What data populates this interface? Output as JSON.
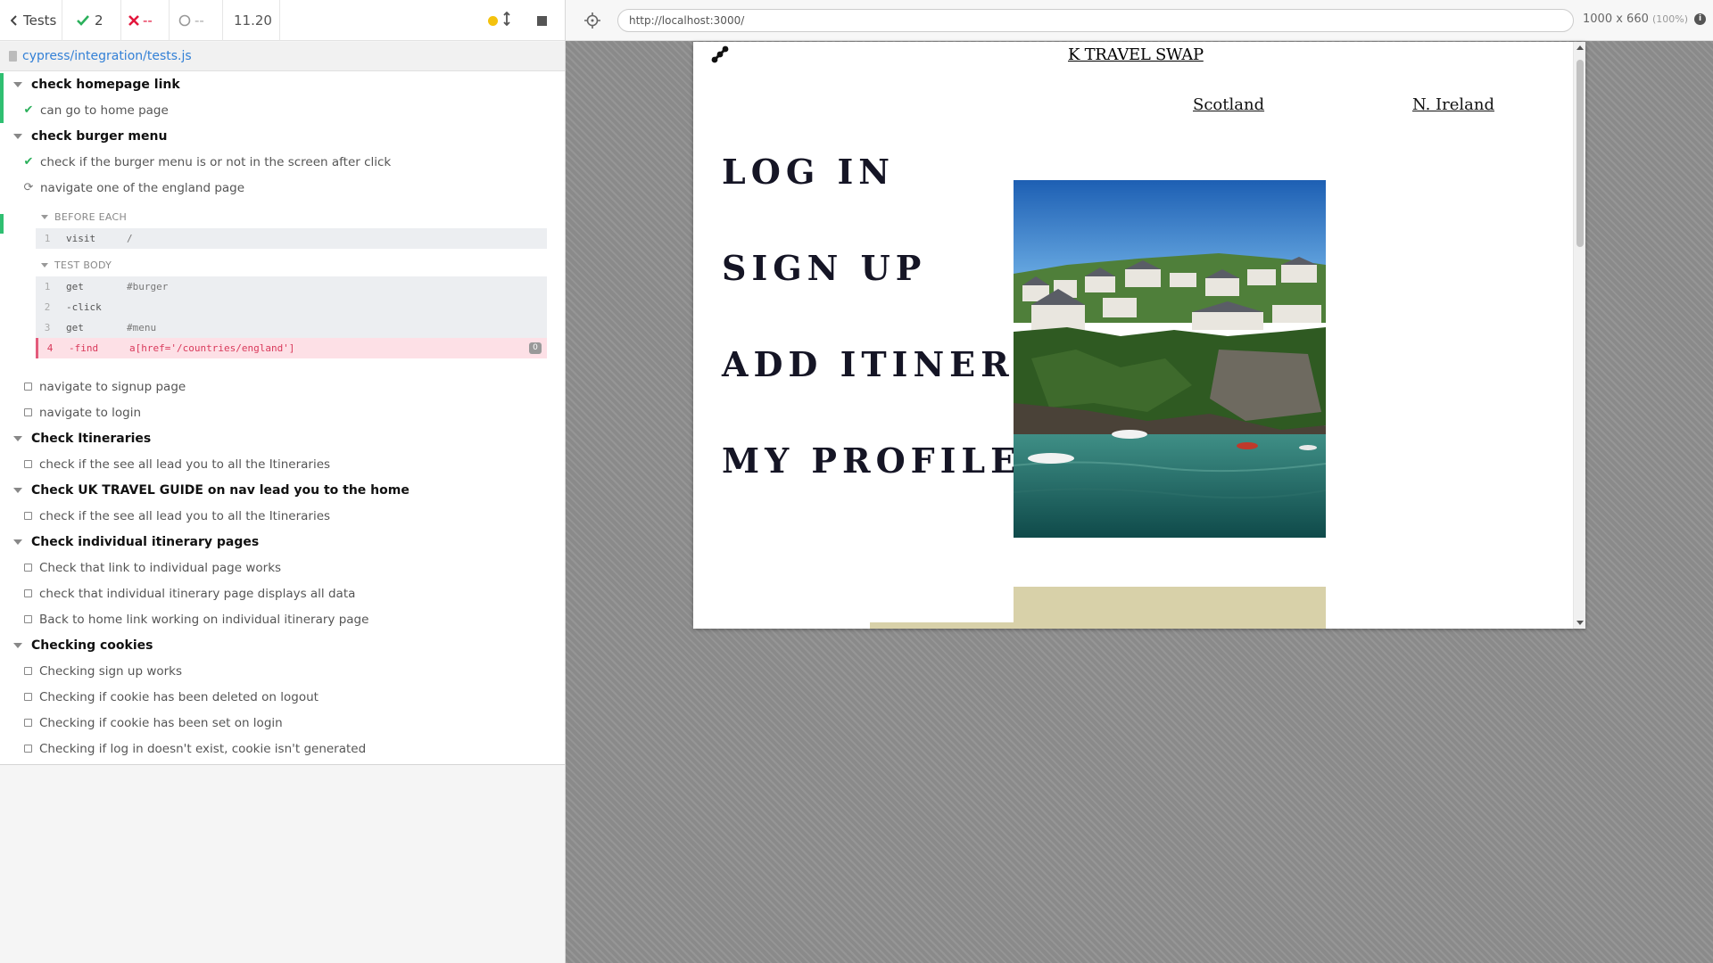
{
  "reporter": {
    "header": {
      "tests_label": "Tests",
      "passed": "2",
      "failed": "--",
      "pending": "--",
      "duration": "11.20"
    },
    "spec_path": "cypress/integration/tests.js",
    "suites": [
      {
        "title": "check homepage link",
        "tests": [
          {
            "title": "can go to home page",
            "state": "passed"
          }
        ]
      },
      {
        "title": "check burger menu",
        "tests": [
          {
            "title": "check if the burger menu is or not in the screen after click",
            "state": "passed"
          },
          {
            "title": "navigate one of the england page",
            "state": "running"
          },
          {
            "title": "navigate to signup page",
            "state": "pending"
          },
          {
            "title": "navigate to login",
            "state": "pending"
          }
        ]
      },
      {
        "title": "Check Itineraries",
        "tests": [
          {
            "title": "check if the see all lead you to all the Itineraries",
            "state": "pending"
          }
        ]
      },
      {
        "title": "Check UK TRAVEL GUIDE on nav lead you to the home",
        "tests": [
          {
            "title": "check if the see all lead you to all the Itineraries",
            "state": "pending"
          }
        ]
      },
      {
        "title": "Check individual itinerary pages",
        "tests": [
          {
            "title": "Check that link to individual page works",
            "state": "pending"
          },
          {
            "title": "check that individual itinerary page displays all data",
            "state": "pending"
          },
          {
            "title": "Back to home link working on individual itinerary page",
            "state": "pending"
          }
        ]
      },
      {
        "title": "Checking cookies",
        "tests": [
          {
            "title": "Checking sign up works",
            "state": "pending"
          },
          {
            "title": "Checking if cookie has been deleted on logout",
            "state": "pending"
          },
          {
            "title": "Checking if cookie has been set on login",
            "state": "pending"
          },
          {
            "title": "Checking if log in doesn't exist, cookie isn't generated",
            "state": "pending"
          }
        ]
      }
    ],
    "hooks": {
      "before_each": {
        "title": "BEFORE EACH",
        "commands": [
          {
            "num": "1",
            "name": "visit",
            "arg": "/"
          }
        ]
      },
      "test_body": {
        "title": "TEST BODY",
        "commands": [
          {
            "num": "1",
            "name": "get",
            "arg": "#burger"
          },
          {
            "num": "2",
            "name": "-click",
            "arg": ""
          },
          {
            "num": "3",
            "name": "get",
            "arg": "#menu"
          },
          {
            "num": "4",
            "name": "-find",
            "arg": "a[href='/countries/england']",
            "badge": "0",
            "state": "failed"
          }
        ]
      }
    }
  },
  "runner": {
    "url": "http://localhost:3000/",
    "viewport": "1000 x 660",
    "zoom": "(100%)"
  },
  "app": {
    "site_title": "K TRAVEL SWAP",
    "regions": [
      "Scotland",
      "N. Ireland"
    ],
    "menu": [
      "LOG IN",
      "SIGN UP",
      "ADD ITINERARY",
      "MY PROFILE"
    ]
  },
  "colors": {
    "pass": "#2bb05b",
    "fail": "#e3163c",
    "link": "#3380d6",
    "tan": "#d8d1a9"
  }
}
